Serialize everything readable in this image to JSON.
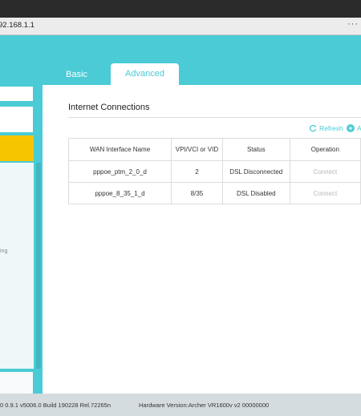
{
  "browser": {
    "url": "92.168.1.1",
    "menu": "···"
  },
  "tabs": {
    "basic": "Basic",
    "advanced": "Advanced"
  },
  "sidebar": {
    "partial_label": "ing"
  },
  "section": {
    "title": "Internet Connections",
    "refresh": "Refresh",
    "add": "A"
  },
  "table": {
    "headers": [
      "WAN Interface Name",
      "VPI/VCI or VID",
      "Status",
      "Operation"
    ],
    "rows": [
      [
        "pppoe_ptm_2_0_d",
        "2",
        "DSL Disconnected",
        "Connect"
      ],
      [
        "pppoe_8_35_1_d",
        "8/35",
        "DSL Disabled",
        "Connect"
      ]
    ]
  },
  "footer": {
    "firmware": "0 0.9.1 v5006.0 Build 190228 Rel.72265n",
    "hardware": "Hardware Version:Archer VR1600v v2 00000000"
  },
  "colors": {
    "accent": "#4acbd6",
    "sidebar_active": "#f6c500"
  }
}
